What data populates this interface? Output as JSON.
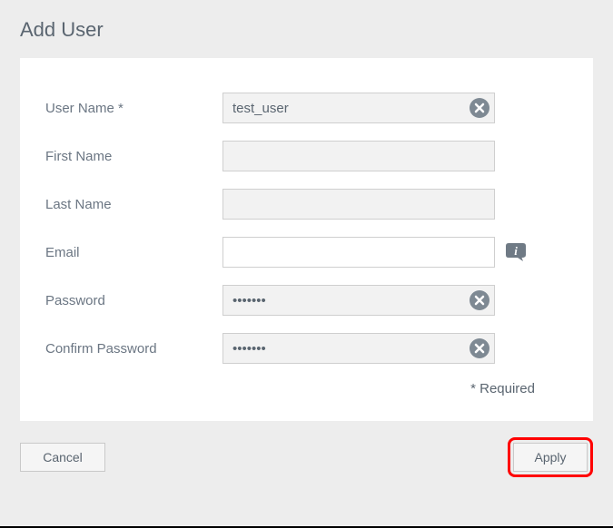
{
  "title": "Add User",
  "fields": {
    "username": {
      "label": "User Name *",
      "value": "test_user"
    },
    "firstname": {
      "label": "First Name",
      "value": ""
    },
    "lastname": {
      "label": "Last Name",
      "value": ""
    },
    "email": {
      "label": "Email",
      "value": ""
    },
    "password": {
      "label": "Password",
      "value": "•••••••"
    },
    "confirm": {
      "label": "Confirm Password",
      "value": "•••••••"
    }
  },
  "requiredNote": "* Required",
  "buttons": {
    "cancel": "Cancel",
    "apply": "Apply"
  }
}
